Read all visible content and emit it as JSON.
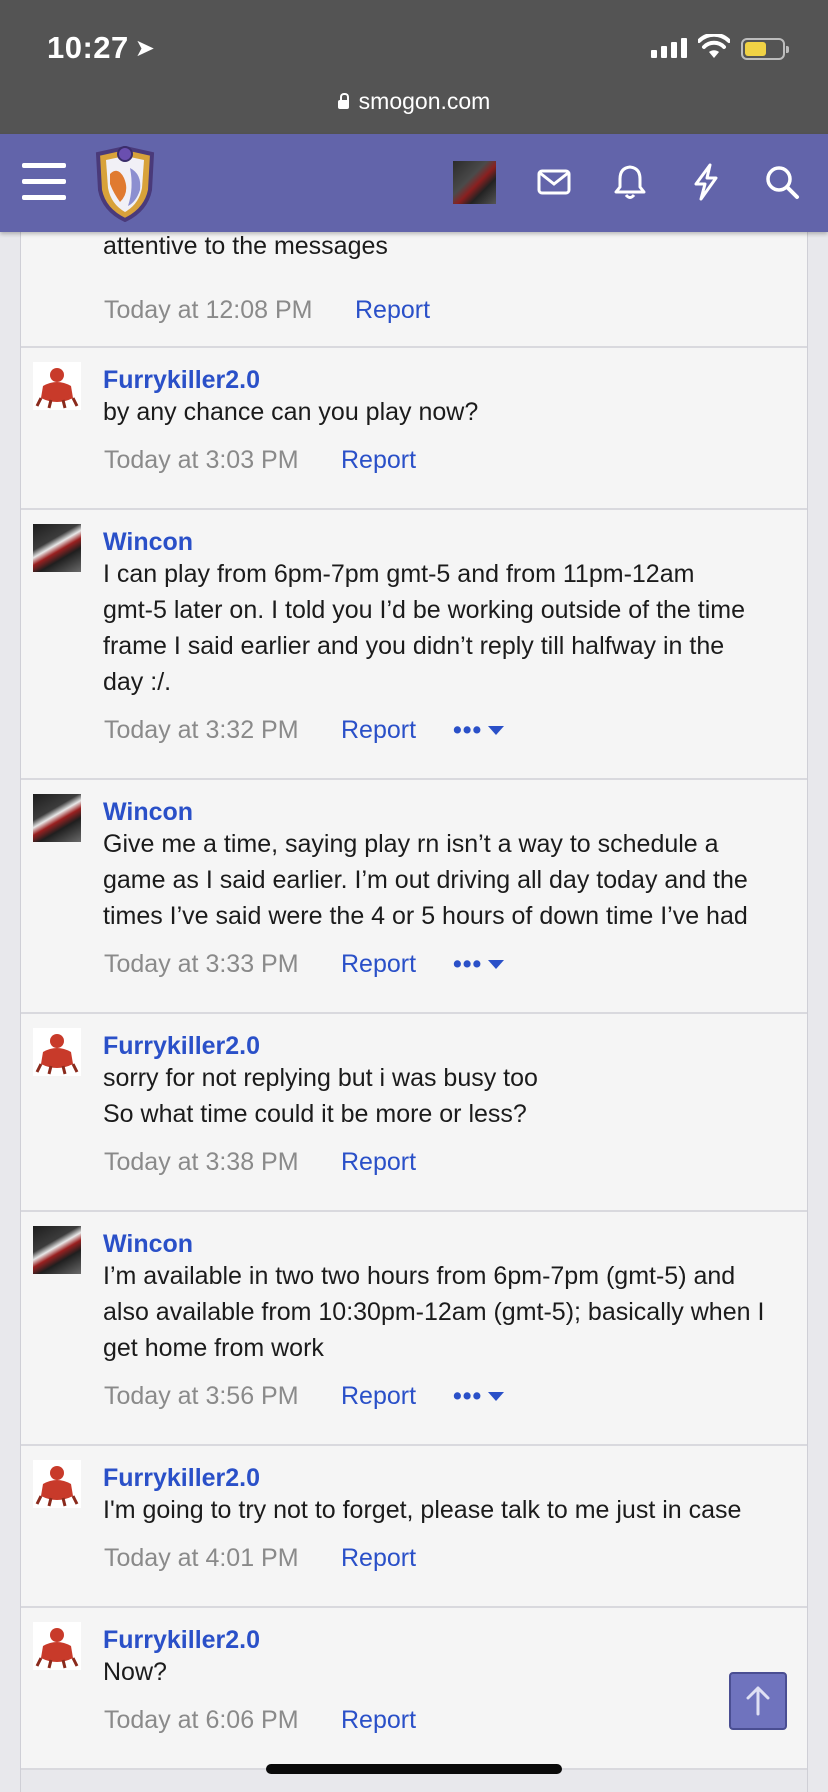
{
  "status": {
    "time": "10:27",
    "url": "smogon.com"
  },
  "nav": {
    "icons": [
      "menu-icon",
      "site-logo",
      "user-avatar",
      "mail-icon",
      "bell-icon",
      "bolt-icon",
      "search-icon"
    ]
  },
  "messages": [
    {
      "user": "",
      "text": "or if you want we can play in a while, I will try to be more\nattentive to the messages",
      "time": "Today at 12:08 PM",
      "report": "Report"
    },
    {
      "user": "Furrykiller2.0",
      "text": "by any chance can you play now?",
      "time": "Today at 3:03 PM",
      "report": "Report"
    },
    {
      "user": "Wincon",
      "text": "I can play from 6pm-7pm gmt-5 and from 11pm-12am\ngmt-5 later on. I told you I’d be working outside of the time\nframe I said earlier and you didn’t reply till halfway in the\nday :/.",
      "time": "Today at 3:32 PM",
      "report": "Report",
      "more": "•••"
    },
    {
      "user": "Wincon",
      "text": "Give me a time, saying play rn isn’t a way to schedule a\ngame as I said earlier. I’m out driving all day today and the\ntimes I’ve said were the 4 or 5 hours of down time I’ve had",
      "time": "Today at 3:33 PM",
      "report": "Report",
      "more": "•••"
    },
    {
      "user": "Furrykiller2.0",
      "text": "sorry for not replying but i was busy too\nSo what time could it be more or less?",
      "time": "Today at 3:38 PM",
      "report": "Report"
    },
    {
      "user": "Wincon",
      "text": "I’m available in two two hours from 6pm-7pm (gmt-5) and\nalso available from 10:30pm-12am (gmt-5); basically when I\nget home from work",
      "time": "Today at 3:56 PM",
      "report": "Report",
      "more": "•••"
    },
    {
      "user": "Furrykiller2.0",
      "text": "I'm going to try not to forget, please talk to me just in case",
      "time": "Today at 4:01 PM",
      "report": "Report"
    },
    {
      "user": "Furrykiller2.0",
      "text": "Now?",
      "time": "Today at 6:06 PM",
      "report": "Report"
    }
  ],
  "colors": {
    "nav": "#6264aa",
    "link": "#2a50c8",
    "status_bar": "#545454"
  }
}
